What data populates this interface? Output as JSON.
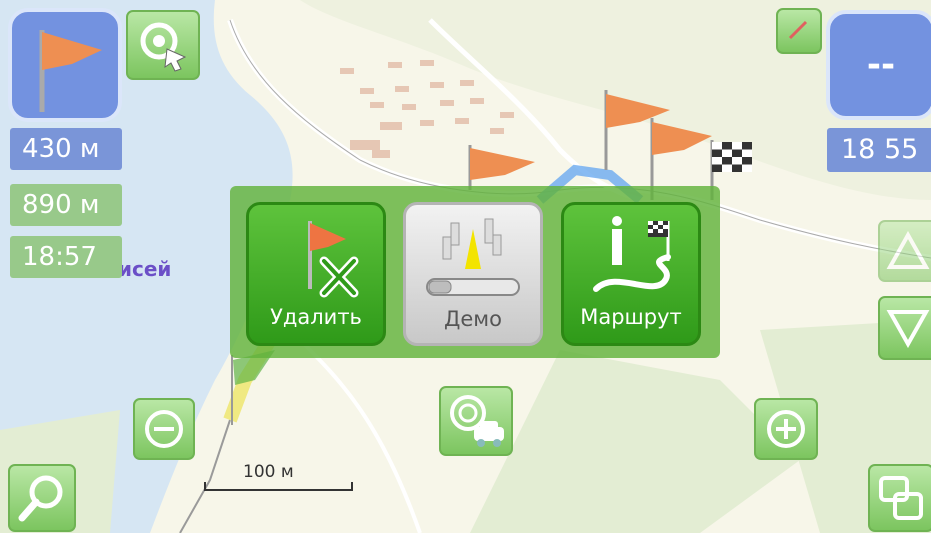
{
  "info": {
    "distance_blue": "430 м",
    "distance_green": "890 м",
    "time_green": "18:57",
    "eta_right": "18 55",
    "direction_placeholder": "--"
  },
  "map": {
    "city_label_fragment": "исей",
    "scale_label": "100 м",
    "colors": {
      "land": "#f7f6e9",
      "water": "#d6e6f3",
      "park": "#e3edd3",
      "accent_blue": "#7392e0",
      "accent_green": "#62b23c"
    }
  },
  "popup": {
    "delete_label": "Удалить",
    "demo_label": "Демо",
    "route_label": "Маршрут"
  },
  "icons": [
    "flag-icon",
    "target-icon",
    "pin-icon",
    "zoom-out-icon",
    "zoom-in-icon",
    "gps-car-icon",
    "search-icon",
    "layers-icon",
    "arrow-up-icon",
    "arrow-down-icon",
    "checkered-flag-icon"
  ]
}
